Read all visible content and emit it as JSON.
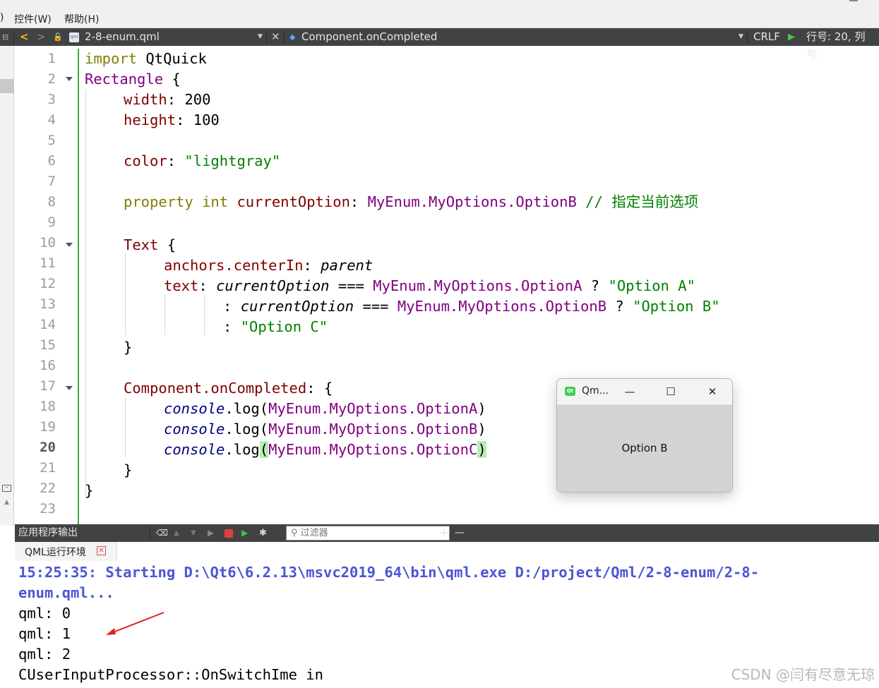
{
  "menubar": {
    "partial": ")",
    "items": [
      "控件(W)",
      "帮助(H)"
    ]
  },
  "editor_toolbar": {
    "back": "<",
    "forward": ">",
    "filename": "2-8-enum.qml",
    "symbol": "Component.onCompleted",
    "line_ending": "CRLF",
    "position": "行号: 20, 列号:"
  },
  "editor": {
    "line_numbers": [
      "1",
      "2",
      "3",
      "4",
      "5",
      "6",
      "7",
      "8",
      "9",
      "10",
      "11",
      "12",
      "13",
      "14",
      "15",
      "16",
      "17",
      "18",
      "19",
      "20",
      "21",
      "22",
      "23"
    ],
    "current_line": "20",
    "code": {
      "l1_kw": "import",
      "l1_mod": " QtQuick",
      "l2_type": "Rectangle",
      "l2_rest": " {",
      "l3_prop": "width",
      "l3_rest": ": 200",
      "l4_prop": "height",
      "l4_rest": ": 100",
      "l6_prop": "color",
      "l6_colon": ": ",
      "l6_str": "\"lightgray\"",
      "l8_kw": "property",
      "l8_type": "int",
      "l8_prop": "currentOption",
      "l8_colon": ": ",
      "l8_val": "MyEnum.MyOptions.OptionB",
      "l8_comment": "// 指定当前选项",
      "l10_type": "Text",
      "l10_rest": " {",
      "l11_prop": "anchors.centerIn",
      "l11_colon": ": ",
      "l11_val": "parent",
      "l12_prop": "text",
      "l12_colon": ": ",
      "l12_var": "currentOption",
      "l12_op": " === ",
      "l12_enum": "MyEnum.MyOptions.OptionA",
      "l12_q": " ? ",
      "l12_str": "\"Option A\"",
      "l13_colon": ": ",
      "l13_var": "currentOption",
      "l13_op": " === ",
      "l13_enum": "MyEnum.MyOptions.OptionB",
      "l13_q": " ? ",
      "l13_str": "\"Option B\"",
      "l14_colon": ": ",
      "l14_str": "\"Option C\"",
      "l15": "}",
      "l17_prop": "Component.onCompleted",
      "l17_rest": ": {",
      "l18_obj": "console",
      "l18_fn": ".log(",
      "l18_enum": "MyEnum.MyOptions.OptionA",
      "l18_close": ")",
      "l19_obj": "console",
      "l19_fn": ".log(",
      "l19_enum": "MyEnum.MyOptions.OptionB",
      "l19_close": ")",
      "l20_obj": "console",
      "l20_fn": ".log",
      "l20_open": "(",
      "l20_enum": "MyEnum.MyOptions.OptionC",
      "l20_close": ")",
      "l21": "}",
      "l22": "}"
    }
  },
  "qml_window": {
    "title": "Qm...",
    "icon_text": "Qt",
    "minimize": "—",
    "maximize": "☐",
    "close": "✕",
    "content": "Option B"
  },
  "output_pane": {
    "title": "应用程序输出",
    "filter_placeholder": "过滤器",
    "plus": "+",
    "minus": "—",
    "tab_label": "QML运行环境",
    "tab_close": "✕",
    "lines": [
      "15:25:35: Starting D:\\Qt6\\6.2.13\\msvc2019_64\\bin\\qml.exe D:/project/Qml/2-8-enum/2-8-",
      "enum.qml...",
      "qml: 0",
      "qml: 1",
      "qml: 2",
      "CUserInputProcessor::OnSwitchIme in"
    ]
  },
  "watermark": "CSDN @闫有尽意无琼",
  "colors": {
    "keyword": "#808000",
    "type": "#800080",
    "property": "#800000",
    "string": "#008000",
    "console": "#000080",
    "status_blue": "#4a55d6",
    "arrow": "#e02020"
  }
}
